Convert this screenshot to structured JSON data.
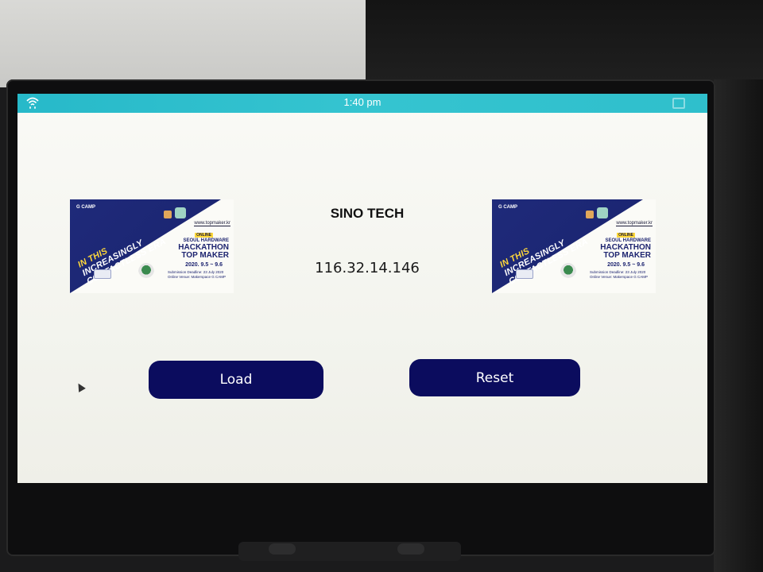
{
  "status_bar": {
    "time": "1:40 pm",
    "left_icon": "wifi-icon",
    "right_icon": "window-icon"
  },
  "main": {
    "title": "SINO TECH",
    "ip_address": "116.32.14.146"
  },
  "banner": {
    "logo": "G CAMP",
    "slogan_line1": "IN THIS",
    "slogan_line2": "INCREASINGLY",
    "slogan_line3": "CONTACTLESS ERA",
    "url": "www.topmaker.kr",
    "badge": "ONLINE",
    "event_line1": "SEOUL HARDWARE",
    "event_line2": "HACKATHON",
    "event_line3": "TOP MAKER",
    "dates": "2020. 9.5 ~ 9.6",
    "deadline": "Submission Deadline: 23 July 2020",
    "venue": "Online Venue: Makerspace G CAMP"
  },
  "buttons": {
    "load_label": "Load",
    "reset_label": "Reset"
  },
  "colors": {
    "status_bar": "#2fbfcc",
    "button_bg": "#0b0c5e",
    "banner_blue": "#1f2a7a",
    "banner_accent": "#ffd83a"
  }
}
